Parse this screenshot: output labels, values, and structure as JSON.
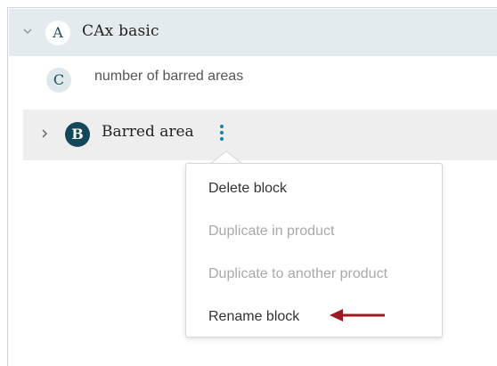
{
  "tree": {
    "row_a": {
      "badge": "A",
      "title": "CAx basic"
    },
    "row_c": {
      "badge": "C",
      "title": "number of barred areas"
    },
    "row_b": {
      "badge": "B",
      "title": "Barred area"
    }
  },
  "context_menu": {
    "items": [
      {
        "label": "Delete block",
        "enabled": true
      },
      {
        "label": "Duplicate in product",
        "enabled": false
      },
      {
        "label": "Duplicate to another product",
        "enabled": false
      },
      {
        "label": "Rename block",
        "enabled": true
      }
    ]
  },
  "colors": {
    "row_a_bg": "#e3ebee",
    "row_b_bg": "#eeeeee",
    "badge_b_bg": "#13475a",
    "kebab": "#1e7fb8",
    "annotation_arrow": "#9b1a22"
  },
  "icons": {
    "expand": "chevron-down-icon",
    "collapse": "chevron-right-icon",
    "more": "more-vertical-icon",
    "annotation": "arrow-left-icon"
  }
}
